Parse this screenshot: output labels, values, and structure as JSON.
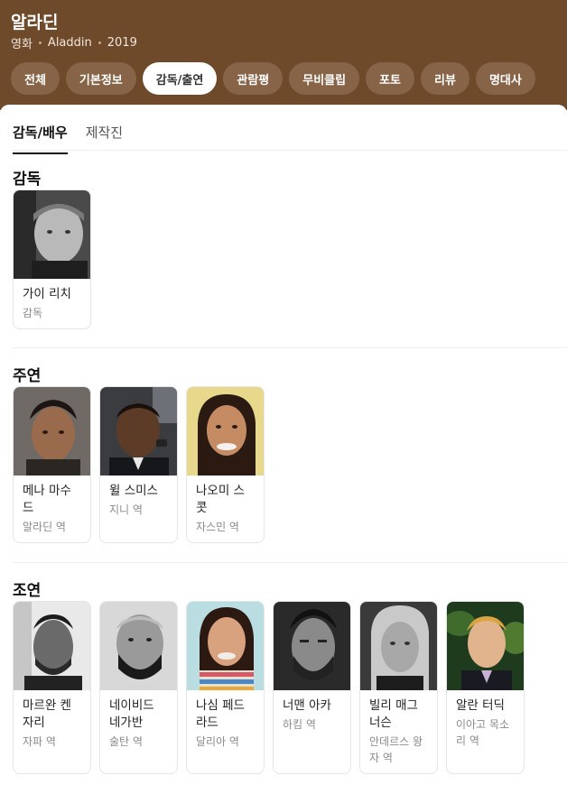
{
  "movie": {
    "title": "알라딘",
    "meta": [
      "영화",
      "Aladdin",
      "2019"
    ]
  },
  "tabs": [
    {
      "label": "전체",
      "active": false
    },
    {
      "label": "기본정보",
      "active": false
    },
    {
      "label": "감독/출연",
      "active": true
    },
    {
      "label": "관람평",
      "active": false
    },
    {
      "label": "무비클립",
      "active": false
    },
    {
      "label": "포토",
      "active": false
    },
    {
      "label": "리뷰",
      "active": false
    },
    {
      "label": "명대사",
      "active": false
    }
  ],
  "subtabs": [
    {
      "label": "감독/배우",
      "active": true
    },
    {
      "label": "제작진",
      "active": false
    }
  ],
  "sections": {
    "director": {
      "title": "감독",
      "people": [
        {
          "name": "가이 리치",
          "role": "감독"
        }
      ]
    },
    "lead": {
      "title": "주연",
      "people": [
        {
          "name": "메나 마수드",
          "role": "알라딘 역"
        },
        {
          "name": "윌 스미스",
          "role": "지니 역"
        },
        {
          "name": "나오미 스콧",
          "role": "자스민 역"
        }
      ]
    },
    "supporting": {
      "title": "조연",
      "people": [
        {
          "name": "마르완 켄자리",
          "role": "자파 역"
        },
        {
          "name": "네이비드 네가반",
          "role": "술탄 역"
        },
        {
          "name": "나심 페드라드",
          "role": "달리아 역"
        },
        {
          "name": "너맨 아카",
          "role": "하킴 역"
        },
        {
          "name": "빌리 매그너슨",
          "role": "안데르스 왕자 역"
        },
        {
          "name": "알란 터딕",
          "role": "이아고 목소리 역"
        }
      ]
    }
  }
}
